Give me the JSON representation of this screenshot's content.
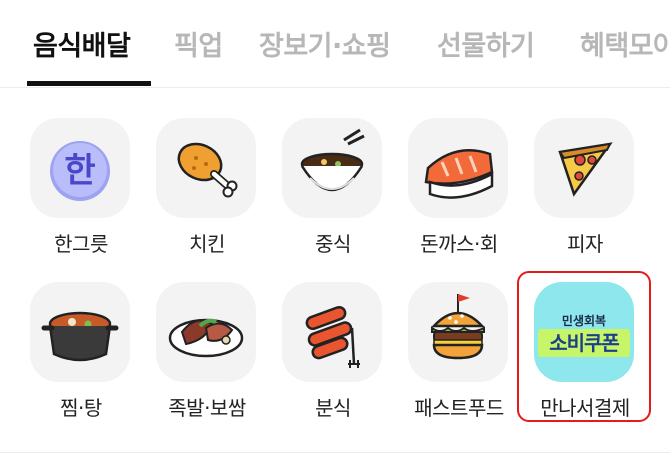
{
  "tabs": [
    {
      "label": "음식배달",
      "active": true
    },
    {
      "label": "픽업",
      "active": false
    },
    {
      "label": "장보기·쇼핑",
      "active": false
    },
    {
      "label": "선물하기",
      "active": false
    },
    {
      "label": "혜택모아",
      "active": false
    }
  ],
  "categories": [
    {
      "label": "한그릇",
      "icon": "korean-character-icon"
    },
    {
      "label": "치킨",
      "icon": "chicken-drumstick-icon"
    },
    {
      "label": "중식",
      "icon": "noodle-bowl-icon"
    },
    {
      "label": "돈까스·회",
      "icon": "sushi-icon"
    },
    {
      "label": "피자",
      "icon": "pizza-slice-icon"
    },
    {
      "label": "찜·탕",
      "icon": "stew-pot-icon"
    },
    {
      "label": "족발·보쌈",
      "icon": "pork-plate-icon"
    },
    {
      "label": "분식",
      "icon": "tteokbokki-icon"
    },
    {
      "label": "패스트푸드",
      "icon": "burger-icon"
    },
    {
      "label": "만나서결제",
      "icon": "coupon-icon"
    }
  ],
  "icon_text": {
    "han": "한"
  },
  "coupon": {
    "small_text": "민생회복",
    "big_text": "소비쿠폰"
  },
  "colors": {
    "active_tab": "#111111",
    "inactive_tab": "#b7b7b7",
    "highlight_border": "#e41b1b",
    "tile_bg": "#f3f3f3",
    "coupon_bg": "#8fe7ee"
  }
}
